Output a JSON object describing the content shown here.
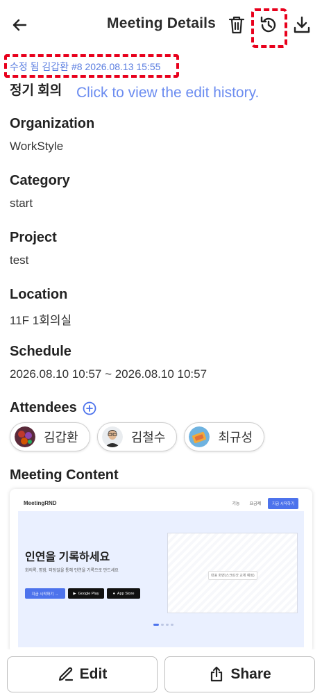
{
  "header": {
    "title": "Meeting Details",
    "back_icon": "arrow-left-icon",
    "delete_icon": "trash-icon",
    "history_icon": "history-icon",
    "download_icon": "download-icon"
  },
  "edit_info": "수정 됨 김갑환 #8 2026.08.13 15:55",
  "tooltip": "Click to view the edit history.",
  "meeting_title": "정기 회의",
  "fields": {
    "organization": {
      "label": "Organization",
      "value": "WorkStyle"
    },
    "category": {
      "label": "Category",
      "value": "start"
    },
    "project": {
      "label": "Project",
      "value": "test"
    },
    "location": {
      "label": "Location",
      "value": "11F 1회의실"
    },
    "schedule": {
      "label": "Schedule",
      "value": "2026.08.10 10:57 ~ 2026.08.10 10:57"
    }
  },
  "attendees": {
    "label": "Attendees",
    "people": [
      {
        "name": "김갑환"
      },
      {
        "name": "김철수"
      },
      {
        "name": "최규성"
      }
    ]
  },
  "meeting_content": {
    "label": "Meeting Content",
    "preview": {
      "logo": "MeetingRND",
      "nav": [
        "기능",
        "요금제"
      ],
      "cta": "지금 시작하기",
      "heading": "인연을 기록하세요",
      "sub": "회의록, 명함, 미팅일을 통해 인연을 기록으로 만드세요",
      "btn_start": "지금 시작하기 →",
      "btn_google": "Google Play",
      "btn_apple": "App Store",
      "frame_label": "대표 화면(스크린샷 교체 예정)"
    }
  },
  "actions": {
    "edit_label": "Edit",
    "share_label": "Share"
  },
  "colors": {
    "accent": "#5a7de0",
    "highlight": "#e8001c"
  }
}
